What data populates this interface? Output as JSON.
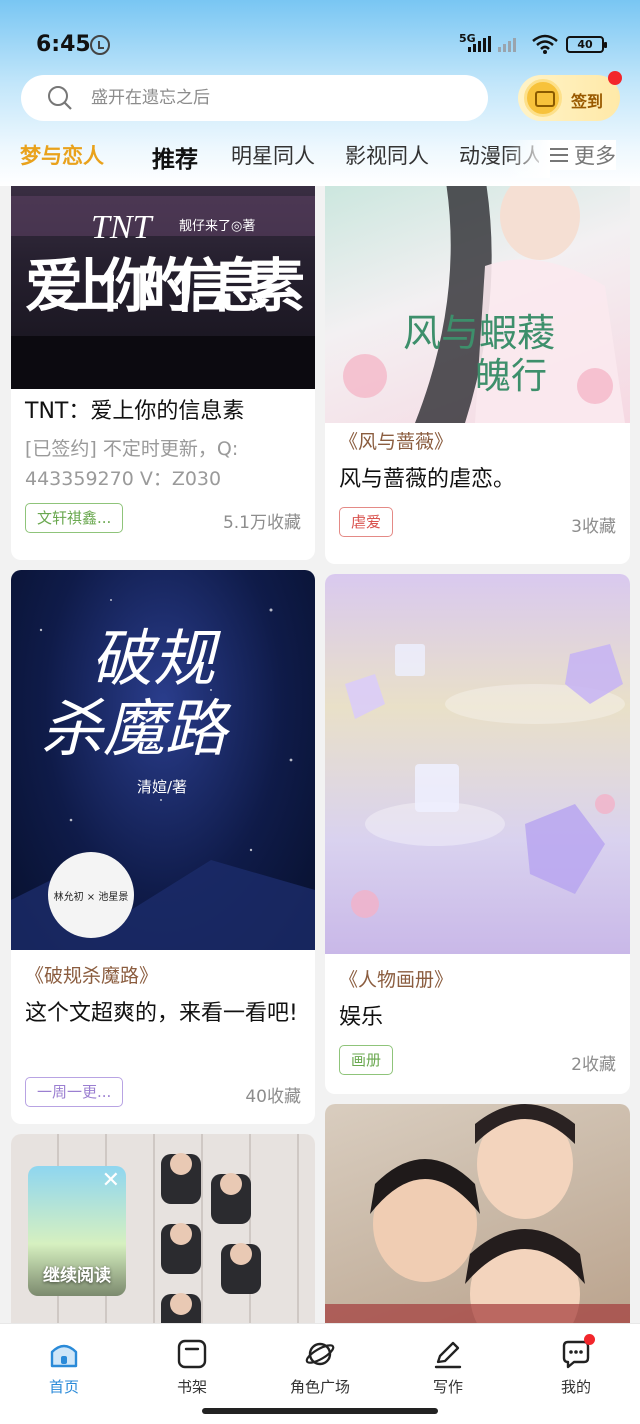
{
  "status_bar": {
    "time": "6:45",
    "network": "5G",
    "battery": "40"
  },
  "search": {
    "placeholder": "盛开在遗忘之后"
  },
  "checkin": {
    "label": "签到"
  },
  "tabs": {
    "items": [
      "梦与恋人",
      "推荐",
      "明星同人",
      "影视同人",
      "动漫同人"
    ],
    "active": "梦与恋人",
    "more_label": "更多"
  },
  "feed": {
    "cards": [
      {
        "cover_title": "爱上你的信息素",
        "cover_prefix": "TNT",
        "cover_author": "靓仔来了◎著",
        "title": "TNT：爱上你的信息素",
        "desc_line1": "[已签约] 不定时更新，Q:",
        "desc_line2": "443359270 V：Z030",
        "tag": "文轩祺鑫...",
        "tag_color": "#6aa84f",
        "favorites": "5.1万收藏"
      },
      {
        "cover_title": "风与蝦薐",
        "cover_title2": "魄行",
        "source": "《风与蔷薇》",
        "title": "风与蔷薇的虐恋。",
        "tag": "虐爱",
        "tag_color": "#d9534f",
        "favorites": "3收藏"
      },
      {
        "cover_title": "破规",
        "cover_title2": "杀魔路",
        "cover_author": "清媗/著",
        "cover_names": "林允初 × 池星景",
        "source": "《破规杀魔路》",
        "title": "这个文超爽的，来看一看吧!",
        "tag": "一周一更...",
        "tag_color": "#9b7fd1",
        "favorites": "40收藏"
      },
      {
        "source": "《人物画册》",
        "title": "娱乐",
        "tag": "画册",
        "tag_color": "#6aa84f",
        "favorites": "2收藏"
      }
    ]
  },
  "continue_reading": {
    "label": "继续阅读",
    "close": "✕"
  },
  "bottom_nav": {
    "items": [
      "首页",
      "书架",
      "角色广场",
      "写作",
      "我的"
    ],
    "active": "首页"
  },
  "colors": {
    "accent_tab": "#e9a21c",
    "nav_active": "#2a8ad8",
    "badge": "#f2262b",
    "source_text": "#8b5d3f"
  }
}
